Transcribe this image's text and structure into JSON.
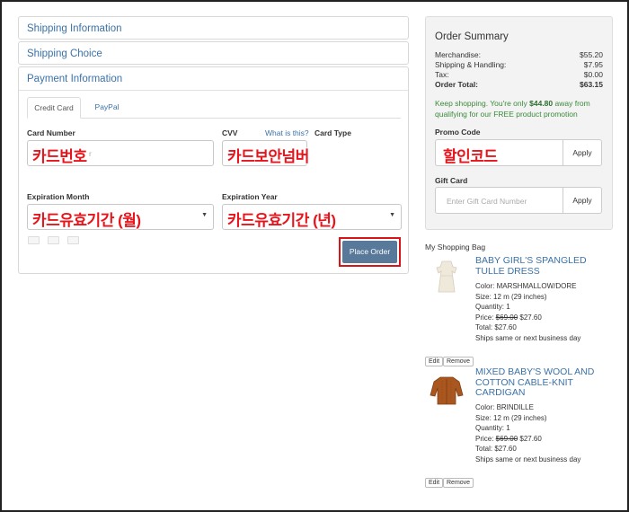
{
  "accordion": {
    "shipping_info": "Shipping Information",
    "shipping_choice": "Shipping Choice",
    "payment_info": "Payment Information"
  },
  "payment": {
    "tabs": [
      {
        "label": "Credit Card",
        "active": true
      },
      {
        "label": "PayPal",
        "active": false
      }
    ],
    "card_number_label": "Card Number",
    "card_number_placeholder": "r",
    "card_number_annotation": "카드번호",
    "cvv_label": "CVV",
    "cvv_help_link": "What is this?",
    "cvv_annotation": "카드보안넘버",
    "card_type_label": "Card Type",
    "exp_month_label": "Expiration Month",
    "exp_month_annotation": "카드유효기간 (월)",
    "exp_year_label": "Expiration Year",
    "exp_year_annotation": "카드유효기간 (년)",
    "place_order": "Place Order"
  },
  "summary": {
    "title": "Order Summary",
    "rows": [
      {
        "label": "Merchandise:",
        "value": "$55.20"
      },
      {
        "label": "Shipping & Handling:",
        "value": "$7.95"
      },
      {
        "label": "Tax:",
        "value": "$0.00"
      },
      {
        "label": "Order Total:",
        "value": "$63.15"
      }
    ],
    "promo_note_before": "Keep shopping. You're only ",
    "promo_note_amount": "$44.80",
    "promo_note_after": " away from qualifying for our FREE product promotion",
    "promo_label": "Promo Code",
    "promo_annotation": "할인코드",
    "promo_apply": "Apply",
    "gift_label": "Gift Card",
    "gift_placeholder": "Enter Gift Card Number",
    "gift_apply": "Apply"
  },
  "bag": {
    "title": "My Shopping Bag",
    "edit": "Edit",
    "remove": "Remove",
    "items": [
      {
        "name_line1": "BABY GIRL'S SPANGLED",
        "name_line2": "TULLE DRESS",
        "color": "Color: MARSHMALLOW/DORE",
        "size": "Size: 12 m (29 inches)",
        "quantity": "Quantity: 1",
        "price_prefix": "Price: ",
        "price_old": "$69.00",
        "price_new": " $27.60",
        "total": "Total: $27.60",
        "ships": "Ships same or next business day"
      },
      {
        "name_line1": "MIXED BABY'S WOOL AND",
        "name_line2": "COTTON CABLE-KNIT",
        "name_line3": "CARDIGAN",
        "color": "Color: BRINDILLE",
        "size": "Size: 12 m (29 inches)",
        "quantity": "Quantity: 1",
        "price_prefix": "Price: ",
        "price_old": "$69.00",
        "price_new": " $27.60",
        "total": "Total: $27.60",
        "ships": "Ships same or next business day"
      }
    ]
  },
  "colors": {
    "link": "#3a72a8",
    "annotation": "#e8141b",
    "button": "#587999",
    "promo_green": "#3c8a3c"
  }
}
